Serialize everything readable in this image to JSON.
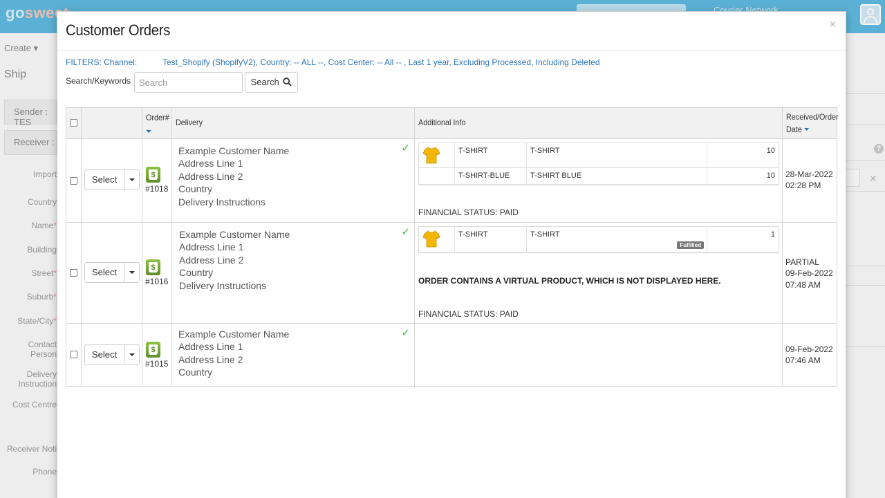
{
  "background": {
    "logo_main": "go",
    "logo_accent": "sweet",
    "courier_network": "Courier Network",
    "create_label": "Create",
    "ship_label": "Ship",
    "sender_label": "Sender : TES",
    "receiver_label": "Receiver :",
    "form_labels": {
      "import": "Import",
      "country": "Country",
      "name": "Name",
      "building": "Building",
      "street": "Street",
      "suburb": "Suburb",
      "state_city": "State/City",
      "contact_person": "Contact Person",
      "delivery_instructions": "Delivery Instruction",
      "cost_centre": "Cost Centre",
      "receiver_notify": "Receiver Noti",
      "phone": "Phone"
    }
  },
  "modal": {
    "title": "Customer Orders",
    "close_glyph": "×",
    "filters_label": "FILTERS: Channel:",
    "filters_value": "Test_Shopify (ShopifyV2), Country: -- ALL --, Cost Center: -- All -- , Last 1 year, Excluding Processed, Including Deleted",
    "search_label": "Search/Keywords",
    "search_placeholder": "Search",
    "search_button": "Search"
  },
  "table": {
    "headers": {
      "order": "Order#",
      "delivery": "Delivery",
      "additional_info": "Additional Info",
      "received_line1": "Received/Order",
      "received_line2": "Date"
    },
    "select_label": "Select",
    "orders": [
      {
        "order_number": "#1018",
        "address": [
          "Example Customer Name",
          "Address Line 1",
          "Address Line 2",
          "Country",
          "Delivery Instructions"
        ],
        "items": [
          {
            "sku": "T-SHIRT",
            "name": "T-SHIRT",
            "qty": "10",
            "badge": "",
            "image": "yellow-tshirt-icon"
          },
          {
            "sku": "T-SHIRT-BLUE",
            "name": "T-SHIRT BLUE",
            "qty": "10",
            "badge": "",
            "image": ""
          }
        ],
        "virtual_note": "",
        "financial_status": "FINANCIAL STATUS: PAID",
        "status": "",
        "date": "28-Mar-2022",
        "time": "02:28 PM"
      },
      {
        "order_number": "#1016",
        "address": [
          "Example Customer Name",
          "Address Line 1",
          "Address Line 2",
          "Country",
          "Delivery Instructions"
        ],
        "items": [
          {
            "sku": "T-SHIRT",
            "name": "T-SHIRT",
            "qty": "1",
            "badge": "Fulfilled",
            "image": "yellow-tshirt-icon"
          }
        ],
        "virtual_note": "ORDER CONTAINS A VIRTUAL PRODUCT, WHICH IS NOT DISPLAYED HERE.",
        "financial_status": "FINANCIAL STATUS: PAID",
        "status": "PARTIAL",
        "date": "09-Feb-2022",
        "time": "07:48 AM"
      },
      {
        "order_number": "#1015",
        "address": [
          "Example Customer Name",
          "Address Line 1",
          "Address Line 2",
          "Country"
        ],
        "items": [],
        "virtual_note": "",
        "financial_status": "",
        "status": "",
        "date": "09-Feb-2022",
        "time": "07:46 AM"
      }
    ]
  },
  "colors": {
    "topbar": "#5fb9de",
    "link_blue": "#2a74b8",
    "check_green": "#3cbf3c",
    "shopify_green": "#7ab03a",
    "tshirt_yellow": "#f2b705"
  }
}
